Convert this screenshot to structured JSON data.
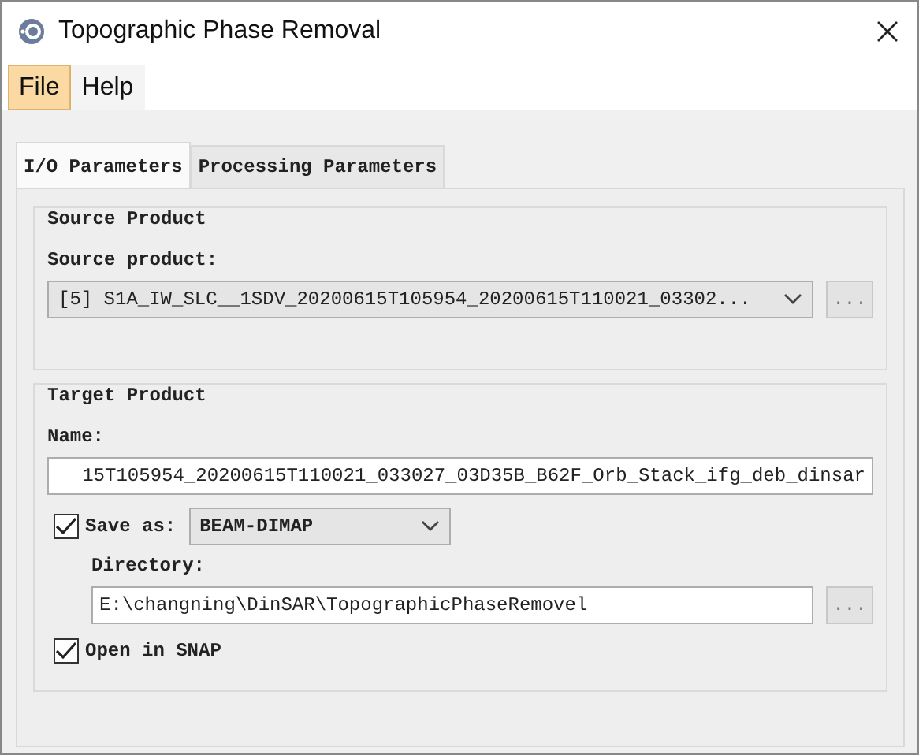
{
  "window": {
    "title": "Topographic Phase Removal"
  },
  "menu": [
    {
      "label": "File",
      "selected": true
    },
    {
      "label": "Help",
      "selected": false
    }
  ],
  "tabs": [
    {
      "label": "I/O Parameters",
      "selected": true
    },
    {
      "label": "Processing Parameters",
      "selected": false
    }
  ],
  "source_product": {
    "title": "Source Product",
    "label": "Source product:",
    "value": "[5] S1A_IW_SLC__1SDV_20200615T105954_20200615T110021_03302...",
    "browse": "..."
  },
  "target_product": {
    "title": "Target Product",
    "name_label": "Name:",
    "name_value": "15T105954_20200615T110021_033027_03D35B_B62F_Orb_Stack_ifg_deb_dinsar",
    "save_as": {
      "label": "Save as:",
      "checked": true,
      "format": "BEAM-DIMAP"
    },
    "directory_label": "Directory:",
    "directory_value": "E:\\changning\\DinSAR\\TopographicPhaseRemovel",
    "browse": "...",
    "open_in_snap": {
      "label": "Open in SNAP",
      "checked": true
    }
  }
}
